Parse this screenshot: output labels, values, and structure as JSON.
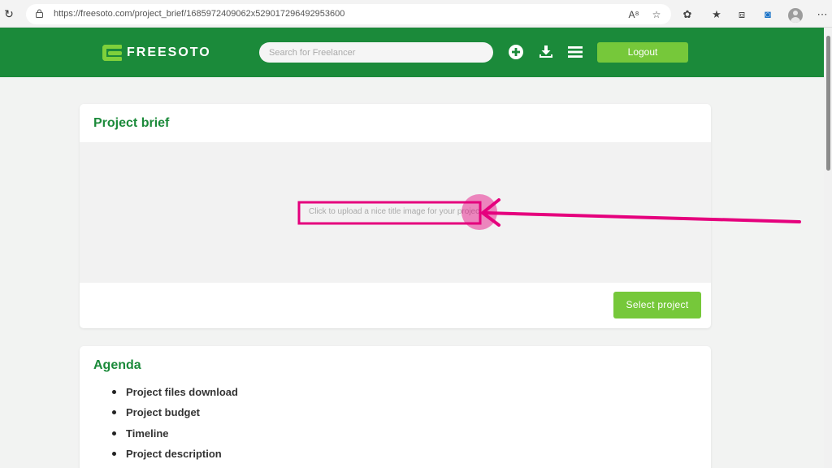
{
  "browser": {
    "url": "https://freesoto.com/project_brief/1685972409062x529017296492953600",
    "icons": [
      "reload-icon",
      "lock-icon",
      "read-aloud-icon",
      "favorite-star-icon",
      "extensions-icon",
      "favorites-icon",
      "collections-icon",
      "edge-browser-icon",
      "profile-icon",
      "more-icon"
    ]
  },
  "header": {
    "logo_text": "FREESOTO",
    "search_placeholder": "Search for Freelancer",
    "logout_label": "Logout",
    "icons": [
      "add-icon",
      "download-icon",
      "menu-icon"
    ]
  },
  "brief": {
    "title": "Project brief",
    "upload_text": "Click to upload a nice title image for your project",
    "select_label": "Select project"
  },
  "agenda": {
    "title": "Agenda",
    "items": [
      "Project files download",
      "Project budget",
      "Timeline",
      "Project description"
    ]
  },
  "colors": {
    "brand_green": "#1b8a3a",
    "accent_green": "#76c83a",
    "annotation_magenta": "#e5007d"
  }
}
